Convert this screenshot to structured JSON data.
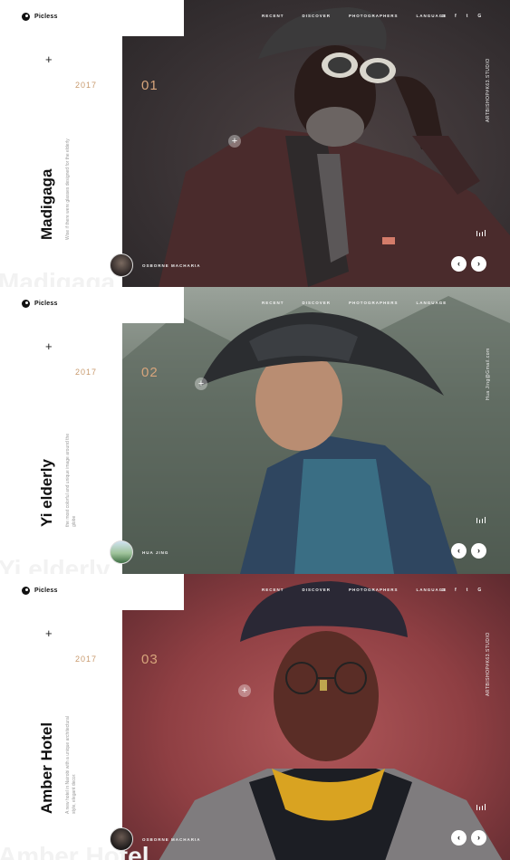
{
  "panels": [
    {
      "brand": "Picless",
      "nav": [
        "RECENT",
        "DISCOVER",
        "PHOTOGRAPHERS",
        "LANGUAGE"
      ],
      "social_icons": [
        "instagram-icon",
        "facebook-icon",
        "twitter-icon",
        "google-icon"
      ],
      "social_glyphs": [
        "◘",
        "f",
        "t",
        "G"
      ],
      "plus": "+",
      "year": "2017",
      "index": "01",
      "title": "Madigaga",
      "description": "Wise if there were glasses designed for the elderly",
      "ghost_title": "Madigaga",
      "side_text": "ARTBISHOP#K63.STUDIO",
      "author": "OSBORNE MACHARIA",
      "prev": "‹",
      "next": "›"
    },
    {
      "brand": "Picless",
      "nav": [
        "RECENT",
        "DISCOVER",
        "PHOTOGRAPHERS",
        "LANGUAGE"
      ],
      "social_icons": [
        "instagram-icon",
        "facebook-icon",
        "twitter-icon",
        "google-icon"
      ],
      "social_glyphs": [
        "◘",
        "f",
        "t",
        "G"
      ],
      "plus": "+",
      "year": "2017",
      "index": "02",
      "title": "Yi elderly",
      "description": "the most colorful and unique image around the globe",
      "ghost_title": "Yi elderly",
      "side_text": "Hua Jing@Gmail.com",
      "author": "HUA JING",
      "prev": "‹",
      "next": "›"
    },
    {
      "brand": "Picless",
      "nav": [
        "RECENT",
        "DISCOVER",
        "PHOTOGRAPHERS",
        "LANGUAGE"
      ],
      "social_icons": [
        "instagram-icon",
        "facebook-icon",
        "twitter-icon",
        "google-icon"
      ],
      "social_glyphs": [
        "◘",
        "f",
        "t",
        "G"
      ],
      "plus": "+",
      "year": "2017",
      "index": "03",
      "title": "Amber Hotel",
      "description": "A new hotel in Nairobi with a unique architectural style, elegant decor.",
      "ghost_title": "Amber Hotel",
      "side_text": "ARTBISHOP#K63.STUDIO",
      "author": "OSBORNE MACHARIA",
      "prev": "‹",
      "next": "›"
    }
  ]
}
